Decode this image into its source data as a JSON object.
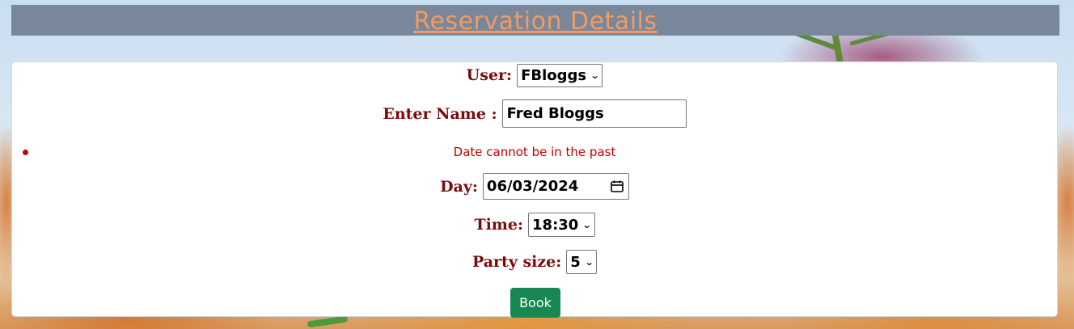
{
  "header": {
    "title": "Reservation Details"
  },
  "form": {
    "user": {
      "label": "User:",
      "selected": "FBloggs"
    },
    "name": {
      "label": "Enter Name :",
      "value": "Fred Bloggs"
    },
    "error": {
      "message": "Date cannot be in the past"
    },
    "day": {
      "label": "Day:",
      "value": "06/03/2024"
    },
    "time": {
      "label": "Time:",
      "selected": "18:30"
    },
    "party_size": {
      "label": "Party size:",
      "selected": "5"
    },
    "submit_label": "Book"
  },
  "colors": {
    "header_bg": "#78889a",
    "header_text": "#f29a61",
    "label_text": "#7a0a0a",
    "error_text": "#c00000",
    "book_button": "#198754"
  }
}
